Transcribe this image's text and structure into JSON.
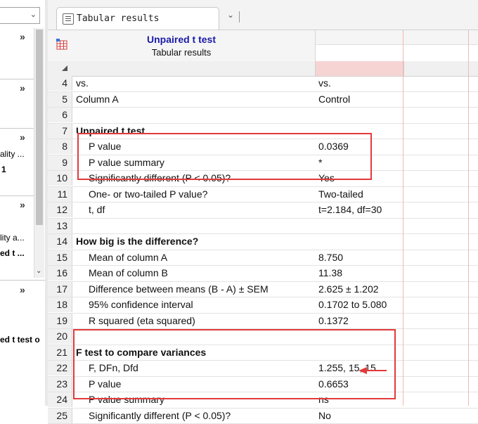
{
  "left_panel": {
    "items": [
      {
        "text": "»"
      },
      {
        "text": "»"
      },
      {
        "text": "»"
      },
      {
        "text": "ality ..."
      },
      {
        "text": "1"
      },
      {
        "text": "»"
      },
      {
        "text": "lity a..."
      },
      {
        "text": "ed t ..."
      },
      {
        "text": "»"
      },
      {
        "text": "ed t test o"
      }
    ]
  },
  "tab": {
    "label": "Tabular results"
  },
  "sheet": {
    "title": "Unpaired t test",
    "subtitle": "Tabular results",
    "rows": [
      {
        "n": "4",
        "label": "vs.",
        "value": "vs.",
        "bold": false,
        "indent": false
      },
      {
        "n": "5",
        "label": "Column A",
        "value": "Control",
        "bold": false,
        "indent": false
      },
      {
        "n": "6",
        "label": "",
        "value": "",
        "bold": false,
        "indent": false
      },
      {
        "n": "7",
        "label": "Unpaired t test",
        "value": "",
        "bold": true,
        "indent": false
      },
      {
        "n": "8",
        "label": "P value",
        "value": "0.0369",
        "bold": false,
        "indent": true
      },
      {
        "n": "9",
        "label": "P value summary",
        "value": "*",
        "bold": false,
        "indent": true
      },
      {
        "n": "10",
        "label": "Significantly different (P < 0.05)?",
        "value": "Yes",
        "bold": false,
        "indent": true
      },
      {
        "n": "11",
        "label": "One- or two-tailed P value?",
        "value": "Two-tailed",
        "bold": false,
        "indent": true
      },
      {
        "n": "12",
        "label": "t, df",
        "value": "t=2.184, df=30",
        "bold": false,
        "indent": true
      },
      {
        "n": "13",
        "label": "",
        "value": "",
        "bold": false,
        "indent": false
      },
      {
        "n": "14",
        "label": "How big is the difference?",
        "value": "",
        "bold": true,
        "indent": false
      },
      {
        "n": "15",
        "label": "Mean of column A",
        "value": "8.750",
        "bold": false,
        "indent": true
      },
      {
        "n": "16",
        "label": "Mean of column B",
        "value": "11.38",
        "bold": false,
        "indent": true
      },
      {
        "n": "17",
        "label": "Difference between means (B - A) ± SEM",
        "value": "2.625 ± 1.202",
        "bold": false,
        "indent": true
      },
      {
        "n": "18",
        "label": "95% confidence interval",
        "value": "0.1702 to 5.080",
        "bold": false,
        "indent": true
      },
      {
        "n": "19",
        "label": "R squared (eta squared)",
        "value": "0.1372",
        "bold": false,
        "indent": true
      },
      {
        "n": "20",
        "label": "",
        "value": "",
        "bold": false,
        "indent": false
      },
      {
        "n": "21",
        "label": "F test to compare variances",
        "value": "",
        "bold": true,
        "indent": false
      },
      {
        "n": "22",
        "label": "F, DFn, Dfd",
        "value": "1.255, 15, 15",
        "bold": false,
        "indent": true
      },
      {
        "n": "23",
        "label": "P value",
        "value": "0.6653",
        "bold": false,
        "indent": true
      },
      {
        "n": "24",
        "label": "P value summary",
        "value": "ns",
        "bold": false,
        "indent": true
      },
      {
        "n": "25",
        "label": "Significantly different (P < 0.05)?",
        "value": "No",
        "bold": false,
        "indent": true
      }
    ]
  },
  "colors": {
    "title": "#1a1aa8",
    "annotation": "#e23a3a",
    "header_highlight": "#f7d4d4"
  }
}
